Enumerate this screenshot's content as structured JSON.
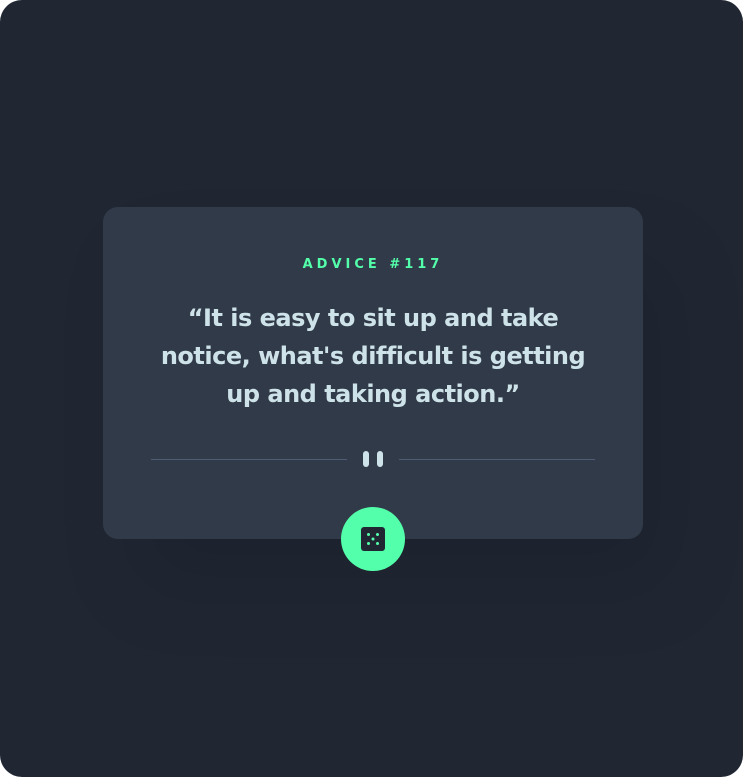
{
  "card": {
    "title": "ADVICE #117",
    "quote": "“It is easy to sit up and take notice, what's difficult is getting up and taking action.”"
  },
  "icons": {
    "divider": "pause-icon",
    "button": "dice-icon"
  },
  "colors": {
    "background": "#202733",
    "card": "#313a48",
    "accent": "#53ffaa",
    "text": "#cee3e9",
    "divider": "#4f5d74"
  }
}
